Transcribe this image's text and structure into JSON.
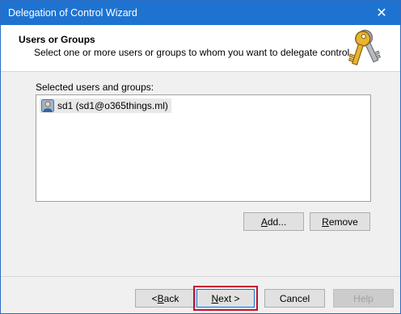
{
  "window": {
    "title": "Delegation of Control Wizard",
    "close_label": "✕"
  },
  "header": {
    "title": "Users or Groups",
    "subtitle": "Select one or more users or groups to whom you want to delegate control.",
    "icon": "keys-icon"
  },
  "list": {
    "label": "Selected users and groups:",
    "items": [
      {
        "icon": "user-icon",
        "text": "sd1 (sd1@o365things.ml)",
        "selected": true
      }
    ]
  },
  "actions": {
    "add": {
      "pre": "",
      "accel": "A",
      "post": "dd..."
    },
    "remove": {
      "pre": "",
      "accel": "R",
      "post": "emove"
    }
  },
  "footer": {
    "back": {
      "pre": "< ",
      "accel": "B",
      "post": "ack"
    },
    "next": {
      "pre": "",
      "accel": "N",
      "post": "ext >"
    },
    "cancel": "Cancel",
    "help": "Help",
    "help_disabled": true,
    "highlight_color": "#c8102e"
  }
}
